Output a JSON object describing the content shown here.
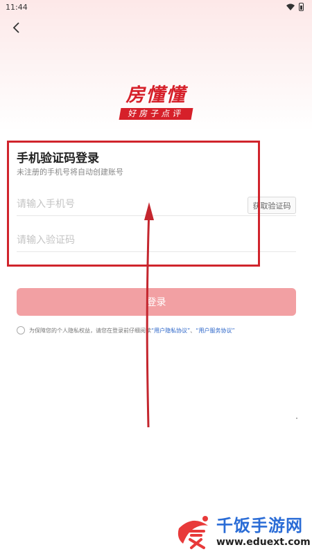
{
  "status_bar": {
    "time": "11:44",
    "icons": [
      "wifi-icon",
      "battery-icon"
    ]
  },
  "header": {
    "back_icon": "chevron-left-icon"
  },
  "logo": {
    "main_text": "房懂懂",
    "sub_text": "好房子点评",
    "color": "#d6202a"
  },
  "login": {
    "title": "手机验证码登录",
    "subtitle": "未注册的手机号将自动创建账号",
    "phone_placeholder": "请输入手机号",
    "get_code_label": "获取验证码",
    "code_placeholder": "请输入验证码",
    "submit_label": "登录"
  },
  "agreement": {
    "prefix": "为保障您的个人隐私权益，请您在登录前仔细阅读",
    "privacy_link": "“用户隐私协议”",
    "separator": "、",
    "service_link": "“用户服务协议”"
  },
  "watermark": {
    "title": "千饭手游网",
    "url": "www.eduext.com",
    "icon": "rice-bowl-logo"
  },
  "colors": {
    "accent": "#d6202a",
    "button": "#f2a0a3",
    "link": "#2a64c8",
    "annotation": "#d0242c"
  }
}
